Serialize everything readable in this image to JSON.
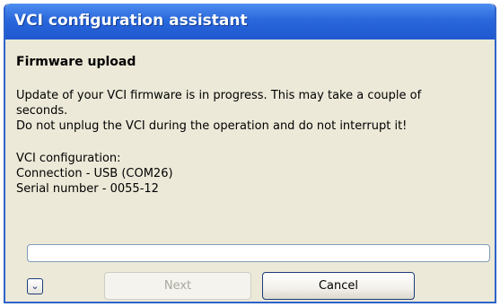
{
  "window": {
    "title": "VCI configuration assistant"
  },
  "content": {
    "section_title": "Firmware upload",
    "paragraph_1_line_1": "Update of your VCI firmware is in progress. This may take a couple of",
    "paragraph_1_line_2": "seconds.",
    "paragraph_1_line_3": "Do not unplug the VCI during the operation and do not interrupt it!",
    "config_heading": "VCI configuration:",
    "connection": "Connection - USB (COM26)",
    "serial": "Serial number - 0055-12"
  },
  "progress": {
    "value": 0,
    "fill_color": "#3cb043"
  },
  "buttons": {
    "expand_icon": "chevron-down-icon",
    "next_label": "Next",
    "next_enabled": false,
    "cancel_label": "Cancel"
  },
  "colors": {
    "title_bar": "#2a68dc",
    "background": "#ece9d8"
  }
}
